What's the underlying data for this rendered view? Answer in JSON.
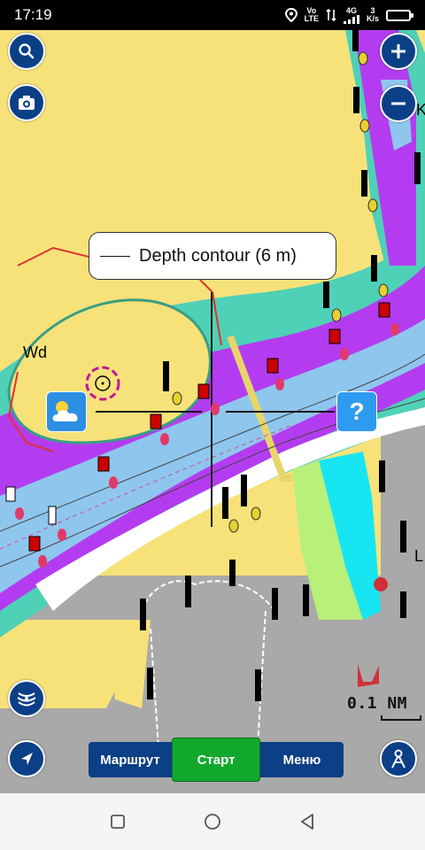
{
  "status_bar": {
    "time": "17:19",
    "network_top": "Vo",
    "network_bottom": "LTE",
    "signal_label": "4G",
    "speed_top": "3",
    "speed_bottom": "K/s"
  },
  "map": {
    "tooltip_text": "Depth contour  (6 m)",
    "label_wd": "Wd",
    "label_l": "L",
    "label_k": "K",
    "scale_text": "0.1 NM",
    "help_text": "?"
  },
  "toolbar": {
    "route_label": "Маршрут",
    "start_label": "Старт",
    "menu_label": "Меню"
  },
  "icons": {
    "search": "search-icon",
    "camera": "camera-icon",
    "zoom_in": "plus-icon",
    "zoom_out": "minus-icon",
    "layers": "sonar-layers-icon",
    "navigation": "navigation-arrow-icon",
    "person": "person-icon",
    "weather": "weather-icon",
    "help": "question-icon"
  },
  "colors": {
    "land": "#f7e27a",
    "deep_water": "#ffffff",
    "purple": "#b43cf0",
    "teal": "#4fd1b7",
    "blue": "#8ec6ee",
    "button": "#0b3f86",
    "start_button": "#12a82e"
  }
}
